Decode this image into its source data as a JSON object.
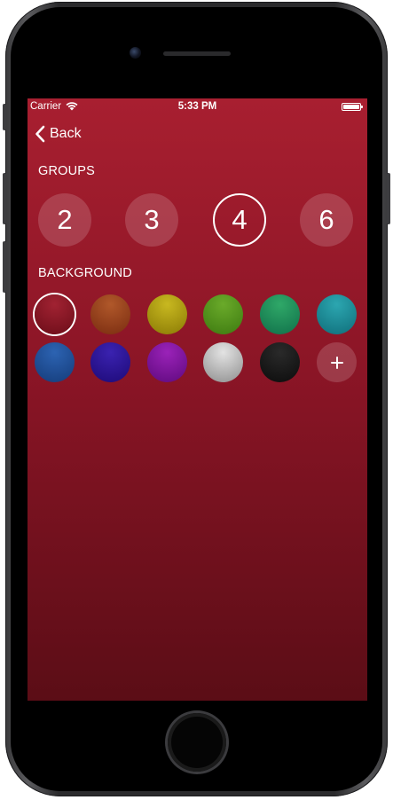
{
  "status_bar": {
    "carrier": "Carrier",
    "time": "5:33 PM"
  },
  "nav": {
    "back_label": "Back"
  },
  "groups": {
    "label": "GROUPS",
    "options": [
      {
        "value": "2",
        "selected": false
      },
      {
        "value": "3",
        "selected": false
      },
      {
        "value": "4",
        "selected": true
      },
      {
        "value": "6",
        "selected": false
      }
    ]
  },
  "background": {
    "label": "BACKGROUND",
    "swatches": [
      {
        "name": "red",
        "top": "#a12232",
        "bottom": "#6b0d18",
        "selected": true
      },
      {
        "name": "orange",
        "top": "#b0582a",
        "bottom": "#7a2c10",
        "selected": false
      },
      {
        "name": "yellow",
        "top": "#c8b820",
        "bottom": "#8a7a05",
        "selected": false
      },
      {
        "name": "green",
        "top": "#6aaa2a",
        "bottom": "#3d7a10",
        "selected": false
      },
      {
        "name": "teal",
        "top": "#2fa868",
        "bottom": "#10704a",
        "selected": false
      },
      {
        "name": "cyan",
        "top": "#2ca6b0",
        "bottom": "#0f6e7a",
        "selected": false
      },
      {
        "name": "blue",
        "top": "#2c63b2",
        "bottom": "#153c7a",
        "selected": false
      },
      {
        "name": "indigo",
        "top": "#3a22b0",
        "bottom": "#1e0a78",
        "selected": false
      },
      {
        "name": "purple",
        "top": "#9a22b8",
        "bottom": "#5f0a7e",
        "selected": false
      },
      {
        "name": "silver",
        "top": "#e3e3e3",
        "bottom": "#8e8e8e",
        "selected": false
      },
      {
        "name": "black",
        "top": "#2a2a2a",
        "bottom": "#0c0c0c",
        "selected": false
      }
    ],
    "add_icon": "plus-icon"
  }
}
